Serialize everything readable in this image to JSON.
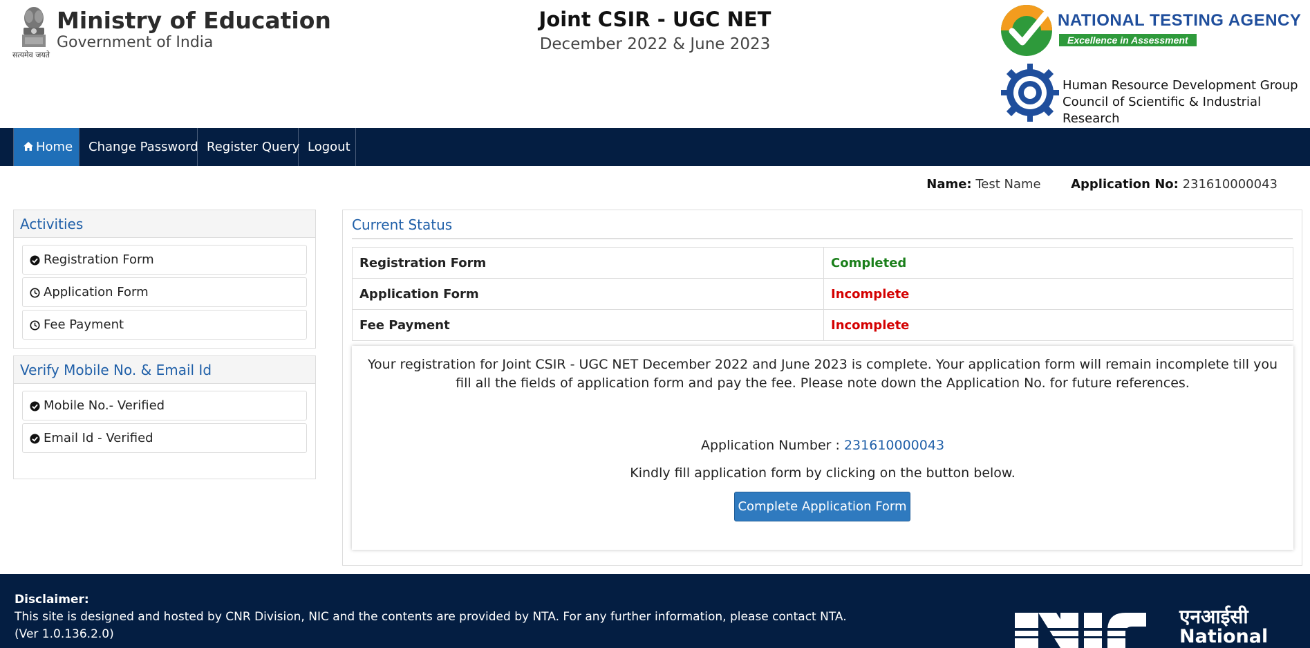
{
  "header": {
    "emblem_caption": "सत्यमेव जयते",
    "ministry_title": "Ministry of Education",
    "ministry_subtitle": "Government of India",
    "exam_title": "Joint CSIR - UGC NET",
    "exam_session": "December 2022 & June 2023",
    "nta_name": "NATIONAL TESTING AGENCY",
    "nta_tagline": "Excellence in Assessment",
    "csir_line1": "Human Resource Development Group",
    "csir_line2": "Council of Scientific & Industrial Research"
  },
  "nav": {
    "home": "Home",
    "change_password": "Change Password",
    "register_query": "Register Query",
    "logout": "Logout"
  },
  "user": {
    "name_label": "Name:",
    "name_value": "Test Name",
    "app_label": "Application No:",
    "app_value": "231610000043"
  },
  "activities": {
    "title": "Activities",
    "items": [
      {
        "label": "Registration Form",
        "icon": "check-circle-icon"
      },
      {
        "label": "Application Form",
        "icon": "clock-icon"
      },
      {
        "label": "Fee Payment",
        "icon": "clock-icon"
      }
    ]
  },
  "verify": {
    "title": "Verify Mobile No. & Email Id",
    "items": [
      {
        "label": "Mobile No.- Verified",
        "icon": "check-circle-icon"
      },
      {
        "label": "Email Id - Verified",
        "icon": "check-circle-icon"
      }
    ]
  },
  "status": {
    "title": "Current Status",
    "rows": [
      {
        "label": "Registration Form",
        "value": "Completed"
      },
      {
        "label": "Application Form",
        "value": "Incomplete"
      },
      {
        "label": "Fee Payment",
        "value": "Incomplete"
      }
    ],
    "message": "Your registration for Joint CSIR - UGC NET December 2022 and June 2023 is complete. Your application form will remain incomplete till you fill all the fields of application form and pay the fee. Please note down the Application No. for future references.",
    "app_number_label": "Application Number :",
    "app_number_value": "231610000043",
    "instruction": "Kindly fill application form by clicking on the button below.",
    "button": "Complete Application Form"
  },
  "footer": {
    "disclaimer_title": "Disclaimer:",
    "disclaimer_text": "This site is designed and hosted by CNR Division, NIC and the contents are provided by NTA. For any further information, please contact NTA. (Ver 1.0.136.2.0)",
    "nic_hindi": "एनआईसी",
    "nic_english": "National"
  },
  "colors": {
    "navbar": "#041e42",
    "nav_active": "#1f6fb8",
    "heading_blue": "#1f5fa8",
    "completed": "#1a7f1a",
    "incomplete": "#d40000",
    "button": "#2f7abf"
  }
}
